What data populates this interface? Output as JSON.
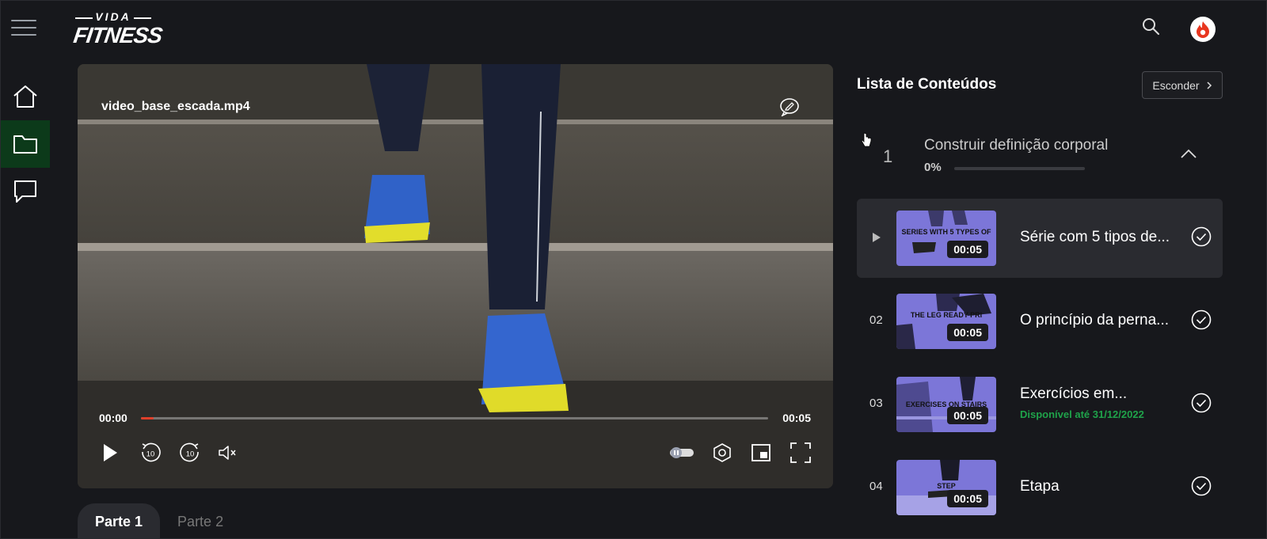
{
  "header": {
    "logo_top": "VIDA",
    "logo_bottom": "FITNESS",
    "search_icon": "search-icon",
    "avatar_icon": "flame-icon"
  },
  "rail": {
    "items": [
      {
        "icon": "home-icon",
        "active": false
      },
      {
        "icon": "folder-icon",
        "active": true
      },
      {
        "icon": "chat-icon",
        "active": false
      }
    ]
  },
  "player": {
    "filename": "video_base_escada.mp4",
    "current_time": "00:00",
    "total_time": "00:05",
    "progress": 0.02,
    "rewind_label": "10",
    "forward_label": "10"
  },
  "tabs": [
    {
      "label": "Parte 1",
      "active": true
    },
    {
      "label": "Parte 2",
      "active": false
    }
  ],
  "panel": {
    "title": "Lista de Conteúdos",
    "hide_label": "Esconder",
    "module": {
      "number": "1",
      "title": "Construir definição corporal",
      "progress_label": "0%",
      "progress": 0
    },
    "lessons": [
      {
        "index": "",
        "current": true,
        "thumb_caption": "SERIES WITH 5 TYPES OF",
        "duration": "00:05",
        "title": "Série com 5 tipos de...",
        "availability": ""
      },
      {
        "index": "02",
        "current": false,
        "thumb_caption": "THE LEG READY PRI",
        "duration": "00:05",
        "title": "O princípio da perna...",
        "availability": ""
      },
      {
        "index": "03",
        "current": false,
        "thumb_caption": "EXERCISES ON STAIRS",
        "duration": "00:05",
        "title": "Exercícios em...",
        "availability": "Disponível até 31/12/2022"
      },
      {
        "index": "04",
        "current": false,
        "thumb_caption": "STEP",
        "duration": "00:05",
        "title": "Etapa",
        "availability": ""
      }
    ]
  },
  "colors": {
    "accent_green": "#1fa34a",
    "active_rail": "#0c3a1a",
    "progress_red": "#e0402a",
    "thumb_purple": "#7c76d8"
  }
}
